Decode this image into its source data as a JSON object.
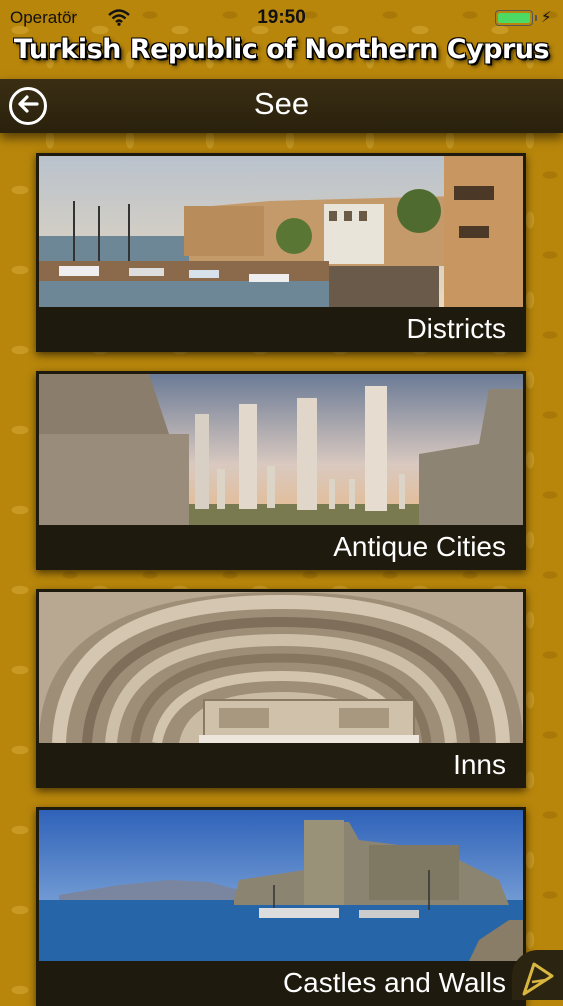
{
  "status_bar": {
    "carrier": "Operatör",
    "time": "19:50",
    "battery_color": "#4cd964"
  },
  "app": {
    "title": "Turkish Republic of Northern Cyprus"
  },
  "nav": {
    "title": "See",
    "back_icon": "arrow-left-circle-icon"
  },
  "categories": [
    {
      "label": "Districts",
      "image": "harbour-castle-photo"
    },
    {
      "label": "Antique Cities",
      "image": "ancient-columns-photo"
    },
    {
      "label": "Inns",
      "image": "gothic-arch-photo"
    },
    {
      "label": "Castles and Walls",
      "image": "coastal-fortress-photo"
    }
  ],
  "colors": {
    "background": "#b8860b",
    "bar": "#2a210c",
    "text": "#ffffff"
  }
}
